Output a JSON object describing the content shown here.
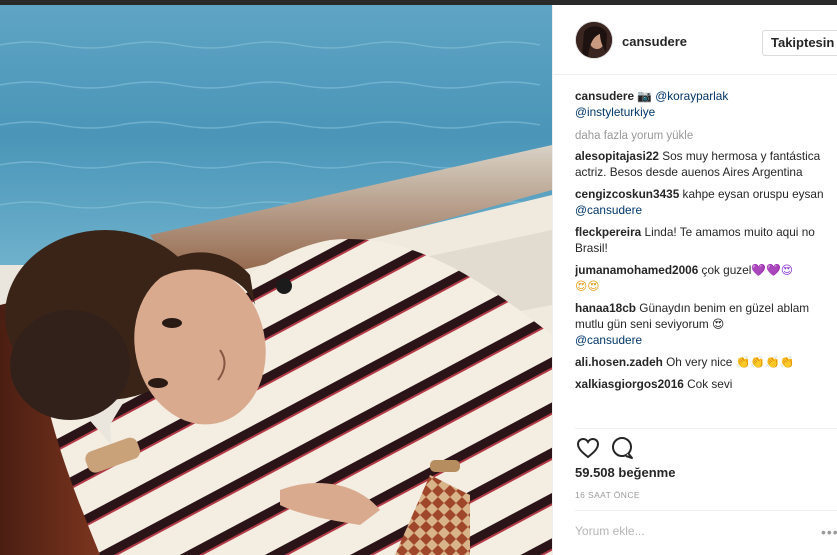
{
  "post": {
    "username": "cansudere",
    "follow_label": "Takiptesin",
    "caption": {
      "user": "cansudere",
      "icon": "camera-emoji",
      "mention1": "@koray​parlak",
      "mention2": "@instyleturkiye"
    },
    "load_more": "daha fazla yorum yükle",
    "comments": [
      {
        "user": "alesopitajasi22",
        "text": "Sos muy hermosa y fantástica actriz. Besos desde auenos Aires Argentina"
      },
      {
        "user": "cengizcoskun3435",
        "text": "kahpe eysan oruspu eysan ",
        "mention": "@cansudere"
      },
      {
        "user": "fleckpereira",
        "text": "Linda! Te amamos muito aqui no Brasil!"
      },
      {
        "user": "jumanamohamed2006",
        "text": "çok guzel",
        "emoji": "💜💜😍",
        "emoji2": "😍😍"
      },
      {
        "user": "hanaa18cb",
        "text": "Günaydın benim en güzel ablam mutlu gün seni seviyorum 😍",
        "mention": "@cansudere"
      },
      {
        "user": "ali.hosen.zadeh",
        "text": "Oh very nice 👏👏👏👏"
      },
      {
        "user": "xalkiasgiorgos2016",
        "text": "Cok sevi"
      }
    ],
    "likes": "59.508 beğenme",
    "time": "16 SAAT ÖNCE",
    "comment_placeholder": "Yorum ekle...",
    "more": "•••"
  },
  "icons": {
    "like": "heart-icon",
    "comment": "comment-bubble-icon",
    "options": "more-options-icon"
  },
  "colors": {
    "mention": "#003569",
    "muted": "#999999",
    "border": "#efefef",
    "text": "#262626"
  }
}
